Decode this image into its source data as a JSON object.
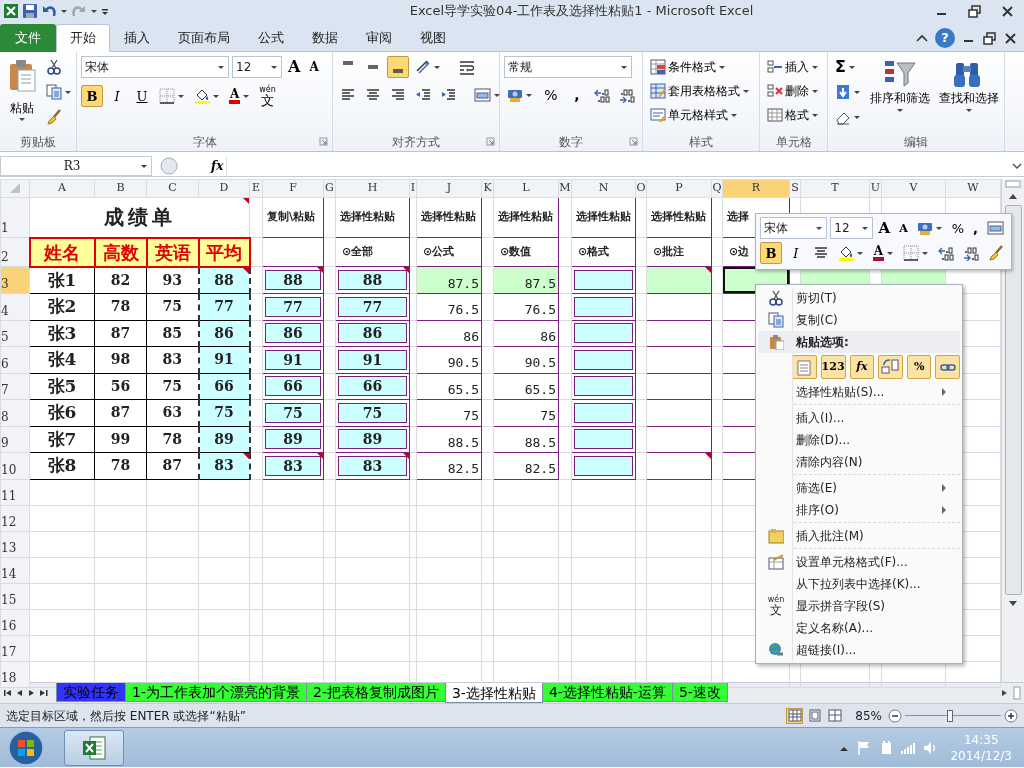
{
  "title_bar": {
    "title": "Excel导学实验04-工作表及选择性粘贴1  -  Microsoft Excel"
  },
  "ribbon_tabs": [
    {
      "label": "文件",
      "kind": "file",
      "selected": false
    },
    {
      "label": "开始",
      "kind": "tab",
      "selected": true
    },
    {
      "label": "插入",
      "kind": "tab",
      "selected": false
    },
    {
      "label": "页面布局",
      "kind": "tab",
      "selected": false
    },
    {
      "label": "公式",
      "kind": "tab",
      "selected": false
    },
    {
      "label": "数据",
      "kind": "tab",
      "selected": false
    },
    {
      "label": "审阅",
      "kind": "tab",
      "selected": false
    },
    {
      "label": "视图",
      "kind": "tab",
      "selected": false
    }
  ],
  "help": "?",
  "ribbon": {
    "clipboard": {
      "label": "剪贴板",
      "paste": "粘贴"
    },
    "font": {
      "label": "字体",
      "font_name": "宋体",
      "font_size": "12",
      "grow": "A",
      "shrink": "A",
      "style_buttons": [
        {
          "label": "B",
          "selected": true
        },
        {
          "label": "I",
          "selected": false
        },
        {
          "label": "U",
          "selected": false
        }
      ],
      "font_color": "A",
      "phonetic": [
        "wén",
        "文"
      ]
    },
    "alignment": {
      "label": "对齐方式",
      "vertical": [
        {
          "selected": false
        },
        {
          "selected": false
        },
        {
          "selected": true
        }
      ]
    },
    "number": {
      "label": "数字",
      "format": "常规",
      "percent": "%",
      "comma": ","
    },
    "styles": {
      "label": "样式",
      "items": [
        "条件格式",
        "套用表格格式",
        "单元格样式"
      ]
    },
    "cells": {
      "label": "单元格",
      "items": [
        "插入",
        "删除",
        "格式"
      ]
    },
    "editing": {
      "label": "编辑",
      "sum": "Σ",
      "items": [
        "排序和筛选",
        "查找和选择"
      ]
    }
  },
  "formula_bar": {
    "name_box": "R3",
    "fx": "fx"
  },
  "grid": {
    "columns": [
      {
        "label": "A",
        "selected": false
      },
      {
        "label": "B",
        "selected": false
      },
      {
        "label": "C",
        "selected": false
      },
      {
        "label": "D",
        "selected": false
      },
      {
        "label": "E",
        "selected": false
      },
      {
        "label": "F",
        "selected": false
      },
      {
        "label": "G",
        "selected": false
      },
      {
        "label": "H",
        "selected": false
      },
      {
        "label": "I",
        "selected": false
      },
      {
        "label": "J",
        "selected": false
      },
      {
        "label": "K",
        "selected": false
      },
      {
        "label": "L",
        "selected": false
      },
      {
        "label": "M",
        "selected": false
      },
      {
        "label": "N",
        "selected": false
      },
      {
        "label": "O",
        "selected": false
      },
      {
        "label": "P",
        "selected": false
      },
      {
        "label": "Q",
        "selected": false
      },
      {
        "label": "R",
        "selected": true
      },
      {
        "label": "S",
        "selected": false
      },
      {
        "label": "T",
        "selected": false
      },
      {
        "label": "U",
        "selected": false
      },
      {
        "label": "V",
        "selected": false
      },
      {
        "label": "W",
        "selected": false
      }
    ],
    "rows": [
      {
        "label": "1",
        "selected": false
      },
      {
        "label": "2",
        "selected": false
      },
      {
        "label": "3",
        "selected": true
      },
      {
        "label": "4",
        "selected": false
      },
      {
        "label": "5",
        "selected": false
      },
      {
        "label": "6",
        "selected": false
      },
      {
        "label": "7",
        "selected": false
      },
      {
        "label": "8",
        "selected": false
      },
      {
        "label": "9",
        "selected": false
      },
      {
        "label": "10",
        "selected": false
      },
      {
        "label": "11",
        "selected": false
      },
      {
        "label": "12",
        "selected": false
      },
      {
        "label": "13",
        "selected": false
      },
      {
        "label": "14",
        "selected": false
      },
      {
        "label": "15",
        "selected": false
      },
      {
        "label": "16",
        "selected": false
      },
      {
        "label": "17",
        "selected": false
      },
      {
        "label": "18",
        "selected": false
      }
    ]
  },
  "score_table": {
    "title": "成绩单",
    "title_comment": true,
    "copy_marquee": true,
    "headers": [
      "姓名",
      "高数",
      "英语",
      "平均"
    ],
    "rows": [
      {
        "name": "张1",
        "math": "82",
        "english": "93",
        "average": "88",
        "average_comment": true
      },
      {
        "name": "张2",
        "math": "78",
        "english": "75",
        "average": "77",
        "average_comment": false
      },
      {
        "name": "张3",
        "math": "87",
        "english": "85",
        "average": "86",
        "average_comment": false
      },
      {
        "name": "张4",
        "math": "98",
        "english": "83",
        "average": "91",
        "average_comment": false
      },
      {
        "name": "张5",
        "math": "56",
        "english": "75",
        "average": "66",
        "average_comment": false
      },
      {
        "name": "张6",
        "math": "87",
        "english": "63",
        "average": "75",
        "average_comment": false
      },
      {
        "name": "张7",
        "math": "99",
        "english": "78",
        "average": "89",
        "average_comment": false
      },
      {
        "name": "张8",
        "math": "78",
        "english": "87",
        "average": "83",
        "average_comment": true
      }
    ]
  },
  "paste_blocks": [
    {
      "header": "复制\\粘贴",
      "kind": "boxed",
      "cells": [
        {
          "value": "88",
          "comment": true,
          "highlighted": false,
          "selected": false
        },
        {
          "value": "77",
          "comment": false,
          "highlighted": false,
          "selected": false
        },
        {
          "value": "86",
          "comment": false,
          "highlighted": false,
          "selected": false
        },
        {
          "value": "91",
          "comment": false,
          "highlighted": false,
          "selected": false
        },
        {
          "value": "66",
          "comment": false,
          "highlighted": false,
          "selected": false
        },
        {
          "value": "75",
          "comment": false,
          "highlighted": false,
          "selected": false
        },
        {
          "value": "89",
          "comment": false,
          "highlighted": false,
          "selected": false
        },
        {
          "value": "83",
          "comment": true,
          "highlighted": false,
          "selected": false
        }
      ]
    },
    {
      "header": "选择性粘贴",
      "option": "⊙全部",
      "kind": "boxed",
      "cells": [
        {
          "value": "88",
          "comment": true,
          "highlighted": false,
          "selected": false
        },
        {
          "value": "77",
          "comment": false,
          "highlighted": false,
          "selected": false
        },
        {
          "value": "86",
          "comment": false,
          "highlighted": false,
          "selected": false
        },
        {
          "value": "91",
          "comment": false,
          "highlighted": false,
          "selected": false
        },
        {
          "value": "66",
          "comment": false,
          "highlighted": false,
          "selected": false
        },
        {
          "value": "75",
          "comment": false,
          "highlighted": false,
          "selected": false
        },
        {
          "value": "89",
          "comment": false,
          "highlighted": false,
          "selected": false
        },
        {
          "value": "83",
          "comment": true,
          "highlighted": false,
          "selected": false
        }
      ]
    },
    {
      "header": "选择性粘贴",
      "option": "⊙公式",
      "kind": "plain",
      "cells": [
        {
          "value": "87.5",
          "comment": false,
          "highlighted": true,
          "selected": false
        },
        {
          "value": "76.5",
          "comment": false,
          "highlighted": false,
          "selected": false
        },
        {
          "value": "86",
          "comment": false,
          "highlighted": false,
          "selected": false
        },
        {
          "value": "90.5",
          "comment": false,
          "highlighted": false,
          "selected": false
        },
        {
          "value": "65.5",
          "comment": false,
          "highlighted": false,
          "selected": false
        },
        {
          "value": "75",
          "comment": false,
          "highlighted": false,
          "selected": false
        },
        {
          "value": "88.5",
          "comment": false,
          "highlighted": false,
          "selected": false
        },
        {
          "value": "82.5",
          "comment": false,
          "highlighted": false,
          "selected": false
        }
      ]
    },
    {
      "header": "选择性粘贴",
      "option": "⊙数值",
      "kind": "plain",
      "cells": [
        {
          "value": "87.5",
          "comment": false,
          "highlighted": true,
          "selected": false
        },
        {
          "value": "76.5",
          "comment": false,
          "highlighted": false,
          "selected": false
        },
        {
          "value": "86",
          "comment": false,
          "highlighted": false,
          "selected": false
        },
        {
          "value": "90.5",
          "comment": false,
          "highlighted": false,
          "selected": false
        },
        {
          "value": "65.5",
          "comment": false,
          "highlighted": false,
          "selected": false
        },
        {
          "value": "75",
          "comment": false,
          "highlighted": false,
          "selected": false
        },
        {
          "value": "88.5",
          "comment": false,
          "highlighted": false,
          "selected": false
        },
        {
          "value": "82.5",
          "comment": false,
          "highlighted": false,
          "selected": false
        }
      ]
    },
    {
      "header": "选择性粘贴",
      "option": "⊙格式",
      "kind": "boxed",
      "cells": [
        {
          "comment": false,
          "highlighted": false,
          "selected": false
        },
        {
          "comment": false,
          "highlighted": false,
          "selected": false
        },
        {
          "comment": false,
          "highlighted": false,
          "selected": false
        },
        {
          "comment": false,
          "highlighted": false,
          "selected": false
        },
        {
          "comment": false,
          "highlighted": false,
          "selected": false
        },
        {
          "comment": false,
          "highlighted": false,
          "selected": false
        },
        {
          "comment": false,
          "highlighted": false,
          "selected": false
        },
        {
          "comment": false,
          "highlighted": false,
          "selected": false
        }
      ]
    },
    {
      "header": "选择性粘贴",
      "option": "⊙批注",
      "kind": "plain",
      "cells": [
        {
          "comment": true,
          "highlighted": true,
          "selected": false
        },
        {
          "comment": false,
          "highlighted": false,
          "selected": false
        },
        {
          "comment": false,
          "highlighted": false,
          "selected": false
        },
        {
          "comment": false,
          "highlighted": false,
          "selected": false
        },
        {
          "comment": false,
          "highlighted": false,
          "selected": false
        },
        {
          "comment": false,
          "highlighted": false,
          "selected": false
        },
        {
          "comment": false,
          "highlighted": false,
          "selected": false
        },
        {
          "comment": true,
          "highlighted": false,
          "selected": false
        }
      ]
    },
    {
      "header": "选择",
      "option": "⊙边",
      "kind": "plain",
      "cells": [
        {
          "comment": false,
          "highlighted": true,
          "selected": true
        },
        {
          "highlighted": false,
          "selected": false
        },
        {
          "highlighted": false,
          "selected": false
        },
        {
          "highlighted": false,
          "selected": false
        },
        {
          "highlighted": false,
          "selected": false
        },
        {
          "highlighted": false,
          "selected": false
        },
        {
          "highlighted": false,
          "selected": false
        },
        {
          "highlighted": false,
          "selected": false
        }
      ]
    },
    {
      "kind": "plain",
      "cells": [
        {
          "comment": false,
          "highlighted": true,
          "selected": false
        }
      ]
    },
    {
      "kind": "plain",
      "cells": [
        {
          "comment": false,
          "highlighted": true,
          "selected": false
        }
      ]
    }
  ],
  "mini_toolbar": {
    "font_name": "宋体",
    "font_size": "12",
    "grow": "A",
    "shrink": "A",
    "percent": "%",
    "comma": ",",
    "style_buttons": [
      {
        "label": "B",
        "selected": true
      },
      {
        "label": "I",
        "selected": false
      }
    ],
    "font_color": "A"
  },
  "context_menu": [
    {
      "kind": "item",
      "label": "剪切(T)",
      "submenu": false
    },
    {
      "kind": "item",
      "label": "复制(C)",
      "submenu": false
    },
    {
      "kind": "heading",
      "label": "粘贴选项:"
    },
    {
      "kind": "paste_options",
      "options": [
        {
          "kind": "all"
        },
        {
          "kind": "values",
          "label": "123"
        },
        {
          "kind": "formulas",
          "label": "fx"
        },
        {
          "kind": "transpose"
        },
        {
          "kind": "formatting",
          "label": "%"
        },
        {
          "kind": "link"
        }
      ]
    },
    {
      "kind": "item",
      "label": "选择性粘贴(S)...",
      "submenu": true
    },
    {
      "kind": "separator"
    },
    {
      "kind": "item",
      "label": "插入(I)...",
      "submenu": false
    },
    {
      "kind": "item",
      "label": "删除(D)...",
      "submenu": false
    },
    {
      "kind": "item",
      "label": "清除内容(N)",
      "submenu": false
    },
    {
      "kind": "separator"
    },
    {
      "kind": "item",
      "label": "筛选(E)",
      "submenu": true
    },
    {
      "kind": "item",
      "label": "排序(O)",
      "submenu": true
    },
    {
      "kind": "separator"
    },
    {
      "kind": "item",
      "label": "插入批注(M)",
      "submenu": false
    },
    {
      "kind": "separator"
    },
    {
      "kind": "item",
      "label": "设置单元格格式(F)...",
      "submenu": false
    },
    {
      "kind": "item",
      "label": "从下拉列表中选择(K)...",
      "submenu": false
    },
    {
      "kind": "item",
      "icon_text": [
        "wén",
        "文"
      ],
      "label": "显示拼音字段(S)",
      "submenu": false
    },
    {
      "kind": "item",
      "label": "定义名称(A)...",
      "submenu": false
    },
    {
      "kind": "item",
      "label": "超链接(I)...",
      "submenu": false
    }
  ],
  "sheet_tabs": [
    {
      "label": "实验任务",
      "color": "#3333ff",
      "selected": false
    },
    {
      "label": "1-为工作表加个漂亮的背景",
      "color": "#33ff33",
      "selected": false
    },
    {
      "label": "2-把表格复制成图片",
      "color": "#33ff33",
      "selected": false
    },
    {
      "label": "3-选择性粘贴",
      "color": "#ffffff",
      "selected": true
    },
    {
      "label": "4-选择性粘贴-运算",
      "color": "#33ff33",
      "selected": false
    },
    {
      "label": "5-速改",
      "color": "#33ff33",
      "selected": false
    }
  ],
  "status_bar": {
    "message": "选定目标区域，然后按 ENTER 或选择“粘贴”",
    "views": [
      {
        "selected": true
      },
      {
        "selected": false
      },
      {
        "selected": false
      }
    ],
    "zoom": "85%",
    "zoom_slider": {
      "level": 0.47
    }
  },
  "taskbar": {
    "time": "14:35",
    "date": "2014/12/3"
  }
}
